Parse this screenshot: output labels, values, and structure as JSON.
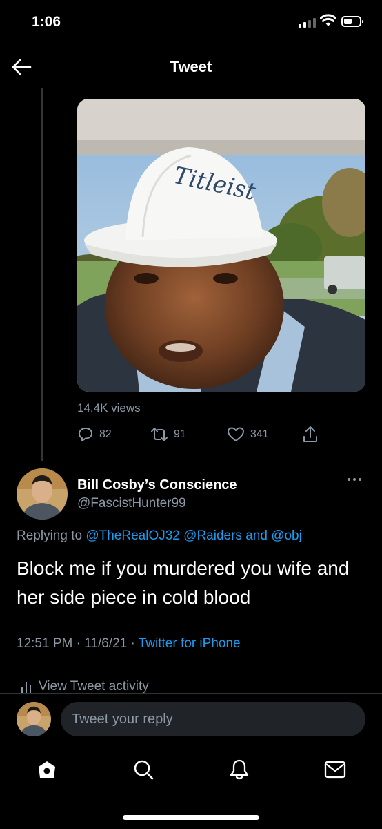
{
  "status_bar": {
    "time": "1:06",
    "battery_level": 0.5
  },
  "header": {
    "title": "Tweet"
  },
  "media": {
    "views": "14.4K views",
    "cap_text": "Titleist"
  },
  "actions": {
    "replies": "82",
    "retweets": "91",
    "likes": "341"
  },
  "reply_tweet": {
    "author_name": "Bill Cosby’s Conscience",
    "author_handle": "@FascistHunter99",
    "replying_to_prefix": "Replying to",
    "mention_1": "@TheRealOJ32",
    "mention_2": "@Raiders",
    "and_word": "and",
    "mention_3": "@obj",
    "text": "Block me if you murdered you wife and her side piece in cold blood",
    "time": "12:51 PM",
    "date": "11/6/21",
    "source": "Twitter for iPhone",
    "view_activity": "View Tweet activity"
  },
  "reply_box": {
    "placeholder": "Tweet your reply"
  },
  "nav": {
    "items": [
      "home-icon",
      "search-icon",
      "notifications-icon",
      "messages-icon"
    ]
  },
  "colors": {
    "background": "#000000",
    "accent": "#1d9bf0",
    "secondary_text": "#8b98a5"
  }
}
